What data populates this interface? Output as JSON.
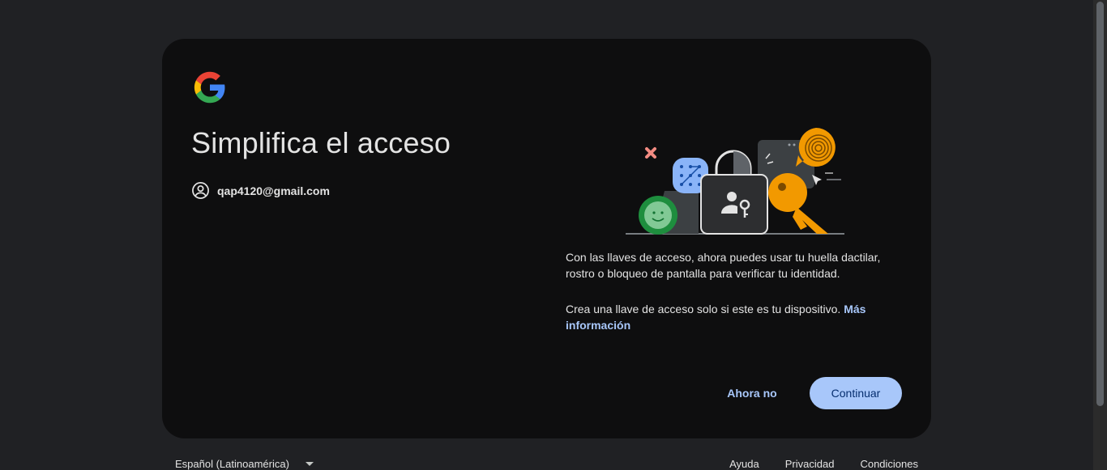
{
  "card": {
    "title": "Simplifica el acceso",
    "account_email": "qap4120@gmail.com",
    "description": "Con las llaves de acceso, ahora puedes usar tu huella dactilar, rostro o bloqueo de pantalla para verificar tu identidad.",
    "notice_text": "Crea una llave de acceso solo si este es tu dispositivo. ",
    "more_info_link": "Más información",
    "secondary_button": "Ahora no",
    "primary_button": "Continuar"
  },
  "footer": {
    "language": "Español (Latinoamérica)",
    "links": [
      "Ayuda",
      "Privacidad",
      "Condiciones"
    ]
  },
  "colors": {
    "background": "#202124",
    "card": "#0e0e0f",
    "accent": "#a8c7fa",
    "primary_button_text": "#062e6f"
  },
  "icons": {
    "logo": "google-logo",
    "account": "account-circle-icon",
    "illustration": "passkey-illustration",
    "language_dropdown": "caret-down-icon"
  }
}
